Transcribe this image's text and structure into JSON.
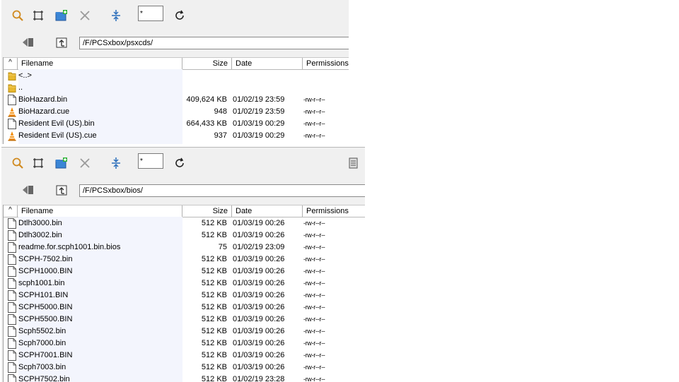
{
  "panes": [
    {
      "filter": "*",
      "path": "/F/PCSxbox/psxcds/",
      "columns": {
        "filename": "Filename",
        "size": "Size",
        "date": "Date",
        "permissions": "Permissions"
      },
      "sort_indicator": "^",
      "files": [
        {
          "name": "<..>",
          "size": "",
          "date": "",
          "perm": "",
          "icon": "folder-icon"
        },
        {
          "name": "..",
          "size": "",
          "date": "",
          "perm": "",
          "icon": "folder-icon"
        },
        {
          "name": "BioHazard.bin",
          "size": "409,624 KB",
          "date": "01/02/19  23:59",
          "perm": "-rw-r--r--",
          "icon": "file-icon"
        },
        {
          "name": "BioHazard.cue",
          "size": "948",
          "date": "01/02/19  23:59",
          "perm": "-rw-r--r--",
          "icon": "cone-icon"
        },
        {
          "name": "Resident Evil (US).bin",
          "size": "664,433 KB",
          "date": "01/03/19  00:29",
          "perm": "-rw-r--r--",
          "icon": "file-icon"
        },
        {
          "name": "Resident Evil (US).cue",
          "size": "937",
          "date": "01/03/19  00:29",
          "perm": "-rw-r--r--",
          "icon": "cone-icon"
        }
      ]
    },
    {
      "filter": "*",
      "path": "/F/PCSxbox/bios/",
      "columns": {
        "filename": "Filename",
        "size": "Size",
        "date": "Date",
        "permissions": "Permissions"
      },
      "sort_indicator": "^",
      "files": [
        {
          "name": "Dtlh3000.bin",
          "size": "512 KB",
          "date": "01/03/19  00:26",
          "perm": "-rw-r--r--",
          "icon": "file-icon"
        },
        {
          "name": "Dtlh3002.bin",
          "size": "512 KB",
          "date": "01/03/19  00:26",
          "perm": "-rw-r--r--",
          "icon": "file-icon"
        },
        {
          "name": "readme.for.scph1001.bin.bios",
          "size": "75",
          "date": "01/02/19  23:09",
          "perm": "-rw-r--r--",
          "icon": "file-icon"
        },
        {
          "name": "SCPH-7502.bin",
          "size": "512 KB",
          "date": "01/03/19  00:26",
          "perm": "-rw-r--r--",
          "icon": "file-icon"
        },
        {
          "name": "SCPH1000.BIN",
          "size": "512 KB",
          "date": "01/03/19  00:26",
          "perm": "-rw-r--r--",
          "icon": "file-icon"
        },
        {
          "name": "scph1001.bin",
          "size": "512 KB",
          "date": "01/03/19  00:26",
          "perm": "-rw-r--r--",
          "icon": "file-icon"
        },
        {
          "name": "SCPH101.BIN",
          "size": "512 KB",
          "date": "01/03/19  00:26",
          "perm": "-rw-r--r--",
          "icon": "file-icon"
        },
        {
          "name": "SCPH5000.BIN",
          "size": "512 KB",
          "date": "01/03/19  00:26",
          "perm": "-rw-r--r--",
          "icon": "file-icon"
        },
        {
          "name": "SCPH5500.BIN",
          "size": "512 KB",
          "date": "01/03/19  00:26",
          "perm": "-rw-r--r--",
          "icon": "file-icon"
        },
        {
          "name": "Scph5502.bin",
          "size": "512 KB",
          "date": "01/03/19  00:26",
          "perm": "-rw-r--r--",
          "icon": "file-icon"
        },
        {
          "name": "Scph7000.bin",
          "size": "512 KB",
          "date": "01/03/19  00:26",
          "perm": "-rw-r--r--",
          "icon": "file-icon"
        },
        {
          "name": "SCPH7001.BIN",
          "size": "512 KB",
          "date": "01/03/19  00:26",
          "perm": "-rw-r--r--",
          "icon": "file-icon"
        },
        {
          "name": "Scph7003.bin",
          "size": "512 KB",
          "date": "01/03/19  00:26",
          "perm": "-rw-r--r--",
          "icon": "file-icon"
        },
        {
          "name": "SCPH7502.bin",
          "size": "512 KB",
          "date": "01/02/19  23:28",
          "perm": "-rw-r--r--",
          "icon": "file-icon"
        }
      ]
    }
  ],
  "toolbar_icons": [
    "find-icon",
    "select-frame-icon",
    "new-folder-icon",
    "delete-icon",
    "sync-icon",
    "refresh-icon"
  ],
  "path_icons": [
    "back-arrow-icon",
    "parent-folder-icon"
  ],
  "colors": {
    "accent": "#2a6ebb",
    "name_column_bg": "#f3f5fd",
    "folder": "#e8b830",
    "cone": "#f28a00"
  }
}
